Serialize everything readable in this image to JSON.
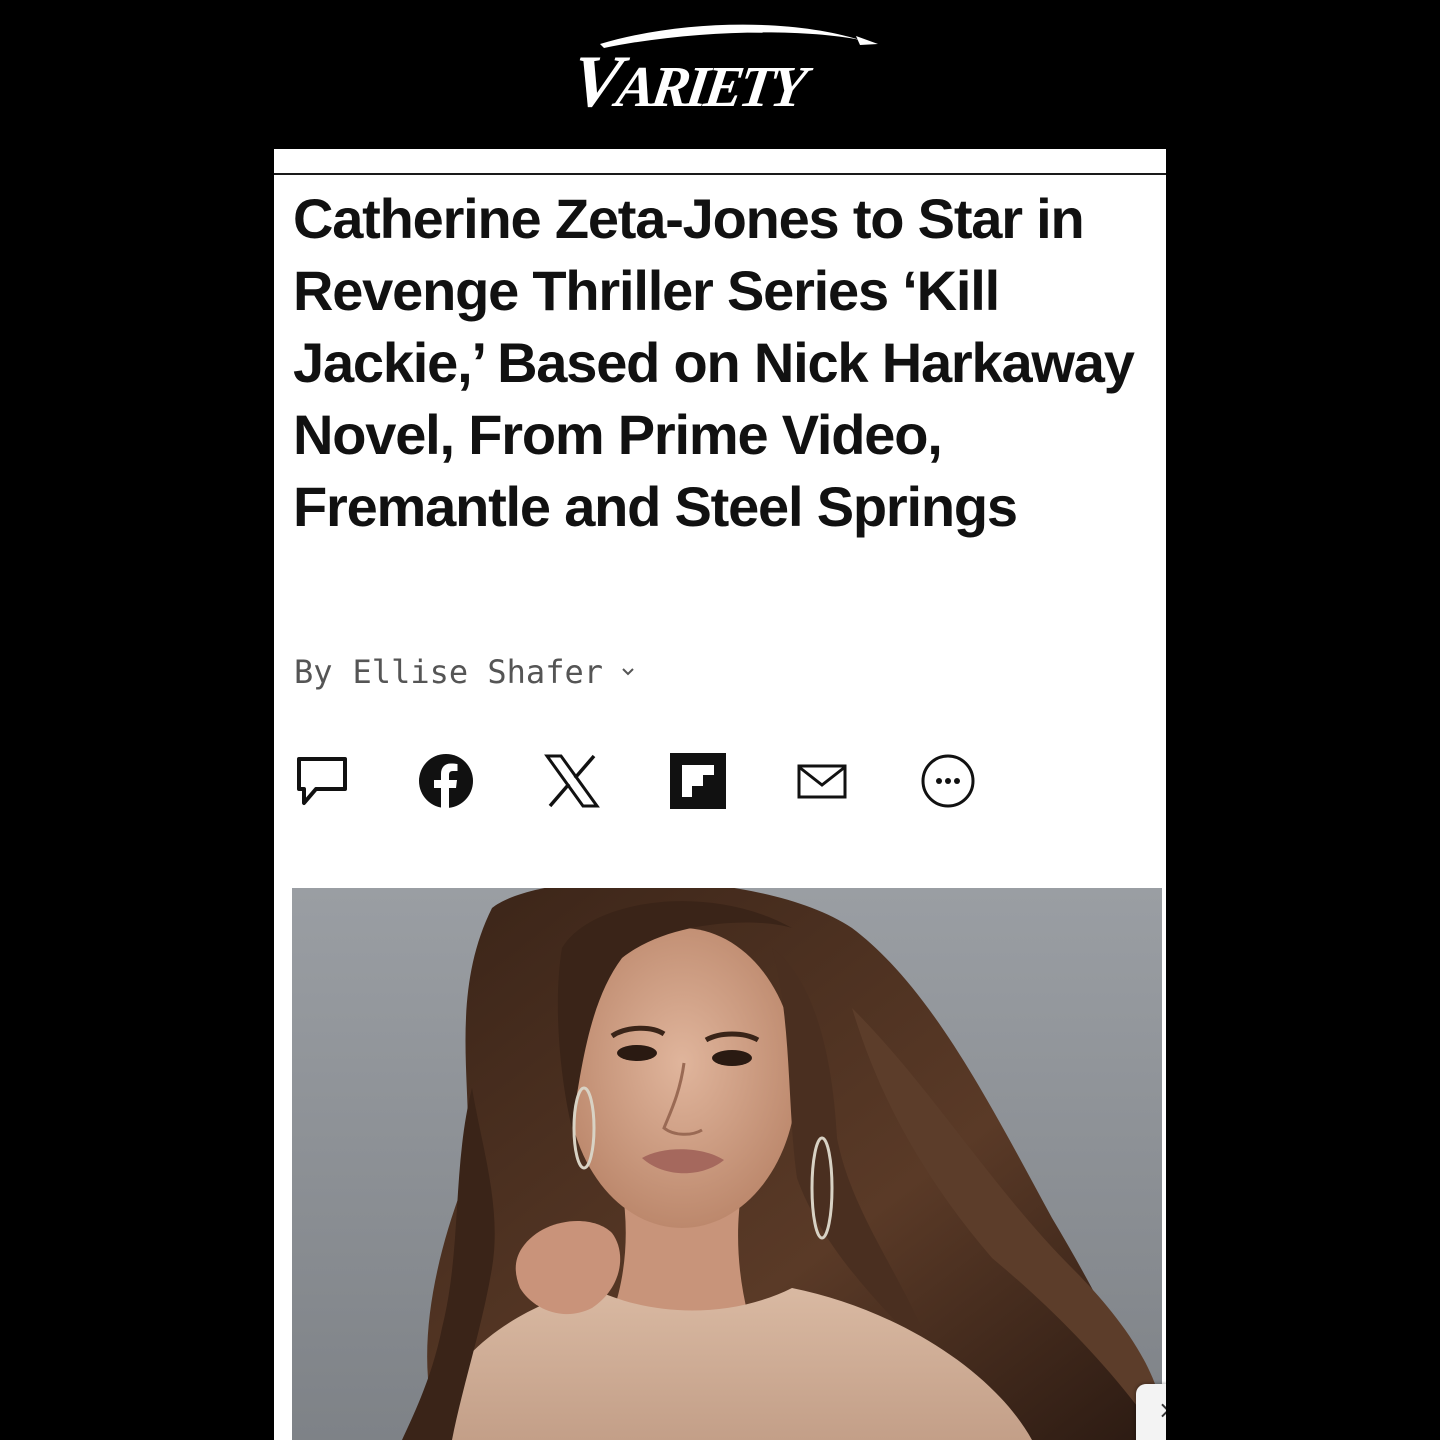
{
  "brand": {
    "logo_text": "VARIETY"
  },
  "article": {
    "headline": "Catherine Zeta-Jones to Star in Revenge Thriller Series ‘Kill Jackie,’ Based on Nick Harkaway Novel, From Prime Video, Fremantle and Steel Springs",
    "byline_prefix": "By",
    "author": "Ellise Shafer"
  },
  "share": {
    "buttons": [
      {
        "icon": "comment-icon"
      },
      {
        "icon": "facebook-icon"
      },
      {
        "icon": "x-icon"
      },
      {
        "icon": "flipboard-icon"
      },
      {
        "icon": "email-icon"
      },
      {
        "icon": "more-icon"
      }
    ]
  },
  "hero_image": {
    "subject": "portrait photo"
  },
  "colors": {
    "page_background": "#000000",
    "card_background": "#ffffff",
    "headline_text": "#111111",
    "byline_text": "#555555"
  }
}
